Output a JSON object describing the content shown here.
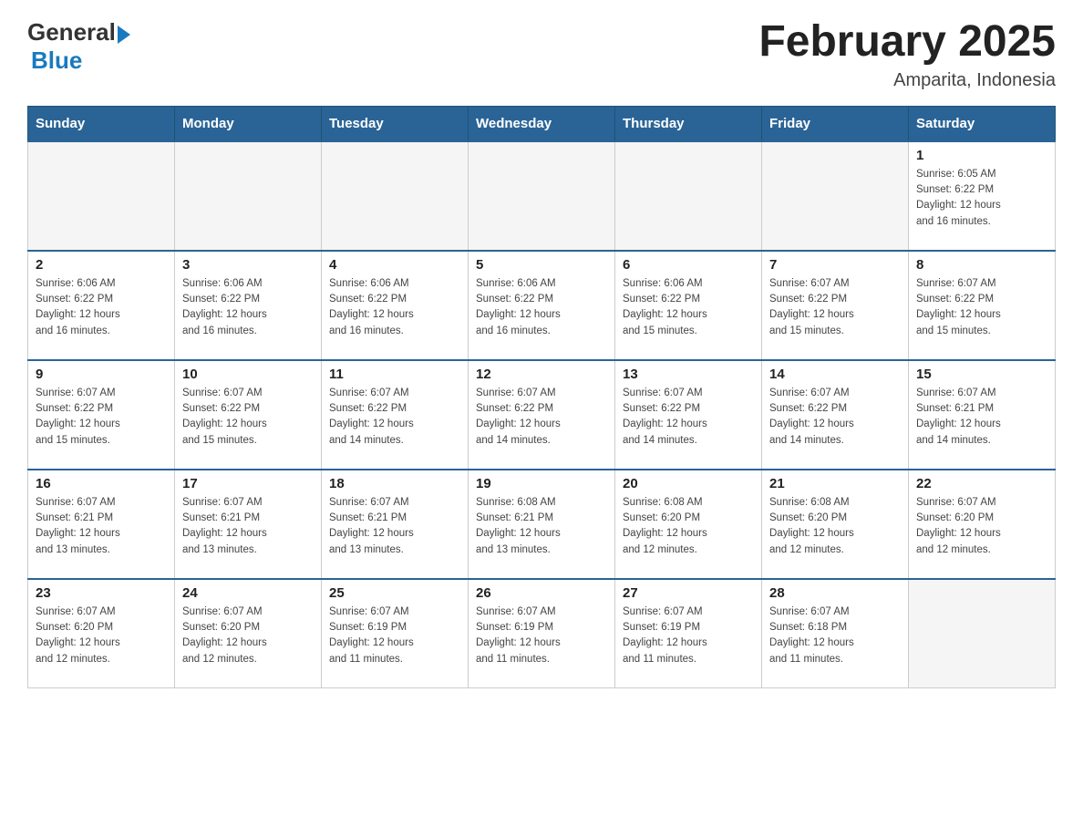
{
  "header": {
    "logo_general": "General",
    "logo_blue": "Blue",
    "month_title": "February 2025",
    "location": "Amparita, Indonesia"
  },
  "weekdays": [
    "Sunday",
    "Monday",
    "Tuesday",
    "Wednesday",
    "Thursday",
    "Friday",
    "Saturday"
  ],
  "weeks": [
    [
      {
        "day": "",
        "empty": true
      },
      {
        "day": "",
        "empty": true
      },
      {
        "day": "",
        "empty": true
      },
      {
        "day": "",
        "empty": true
      },
      {
        "day": "",
        "empty": true
      },
      {
        "day": "",
        "empty": true
      },
      {
        "day": "1",
        "sunrise": "6:05 AM",
        "sunset": "6:22 PM",
        "daylight": "12 hours and 16 minutes."
      }
    ],
    [
      {
        "day": "2",
        "sunrise": "6:06 AM",
        "sunset": "6:22 PM",
        "daylight": "12 hours and 16 minutes."
      },
      {
        "day": "3",
        "sunrise": "6:06 AM",
        "sunset": "6:22 PM",
        "daylight": "12 hours and 16 minutes."
      },
      {
        "day": "4",
        "sunrise": "6:06 AM",
        "sunset": "6:22 PM",
        "daylight": "12 hours and 16 minutes."
      },
      {
        "day": "5",
        "sunrise": "6:06 AM",
        "sunset": "6:22 PM",
        "daylight": "12 hours and 16 minutes."
      },
      {
        "day": "6",
        "sunrise": "6:06 AM",
        "sunset": "6:22 PM",
        "daylight": "12 hours and 15 minutes."
      },
      {
        "day": "7",
        "sunrise": "6:07 AM",
        "sunset": "6:22 PM",
        "daylight": "12 hours and 15 minutes."
      },
      {
        "day": "8",
        "sunrise": "6:07 AM",
        "sunset": "6:22 PM",
        "daylight": "12 hours and 15 minutes."
      }
    ],
    [
      {
        "day": "9",
        "sunrise": "6:07 AM",
        "sunset": "6:22 PM",
        "daylight": "12 hours and 15 minutes."
      },
      {
        "day": "10",
        "sunrise": "6:07 AM",
        "sunset": "6:22 PM",
        "daylight": "12 hours and 15 minutes."
      },
      {
        "day": "11",
        "sunrise": "6:07 AM",
        "sunset": "6:22 PM",
        "daylight": "12 hours and 14 minutes."
      },
      {
        "day": "12",
        "sunrise": "6:07 AM",
        "sunset": "6:22 PM",
        "daylight": "12 hours and 14 minutes."
      },
      {
        "day": "13",
        "sunrise": "6:07 AM",
        "sunset": "6:22 PM",
        "daylight": "12 hours and 14 minutes."
      },
      {
        "day": "14",
        "sunrise": "6:07 AM",
        "sunset": "6:22 PM",
        "daylight": "12 hours and 14 minutes."
      },
      {
        "day": "15",
        "sunrise": "6:07 AM",
        "sunset": "6:21 PM",
        "daylight": "12 hours and 14 minutes."
      }
    ],
    [
      {
        "day": "16",
        "sunrise": "6:07 AM",
        "sunset": "6:21 PM",
        "daylight": "12 hours and 13 minutes."
      },
      {
        "day": "17",
        "sunrise": "6:07 AM",
        "sunset": "6:21 PM",
        "daylight": "12 hours and 13 minutes."
      },
      {
        "day": "18",
        "sunrise": "6:07 AM",
        "sunset": "6:21 PM",
        "daylight": "12 hours and 13 minutes."
      },
      {
        "day": "19",
        "sunrise": "6:08 AM",
        "sunset": "6:21 PM",
        "daylight": "12 hours and 13 minutes."
      },
      {
        "day": "20",
        "sunrise": "6:08 AM",
        "sunset": "6:20 PM",
        "daylight": "12 hours and 12 minutes."
      },
      {
        "day": "21",
        "sunrise": "6:08 AM",
        "sunset": "6:20 PM",
        "daylight": "12 hours and 12 minutes."
      },
      {
        "day": "22",
        "sunrise": "6:07 AM",
        "sunset": "6:20 PM",
        "daylight": "12 hours and 12 minutes."
      }
    ],
    [
      {
        "day": "23",
        "sunrise": "6:07 AM",
        "sunset": "6:20 PM",
        "daylight": "12 hours and 12 minutes."
      },
      {
        "day": "24",
        "sunrise": "6:07 AM",
        "sunset": "6:20 PM",
        "daylight": "12 hours and 12 minutes."
      },
      {
        "day": "25",
        "sunrise": "6:07 AM",
        "sunset": "6:19 PM",
        "daylight": "12 hours and 11 minutes."
      },
      {
        "day": "26",
        "sunrise": "6:07 AM",
        "sunset": "6:19 PM",
        "daylight": "12 hours and 11 minutes."
      },
      {
        "day": "27",
        "sunrise": "6:07 AM",
        "sunset": "6:19 PM",
        "daylight": "12 hours and 11 minutes."
      },
      {
        "day": "28",
        "sunrise": "6:07 AM",
        "sunset": "6:18 PM",
        "daylight": "12 hours and 11 minutes."
      },
      {
        "day": "",
        "empty": true
      }
    ]
  ],
  "labels": {
    "sunrise_prefix": "Sunrise: ",
    "sunset_prefix": "Sunset: ",
    "daylight_prefix": "Daylight: "
  }
}
